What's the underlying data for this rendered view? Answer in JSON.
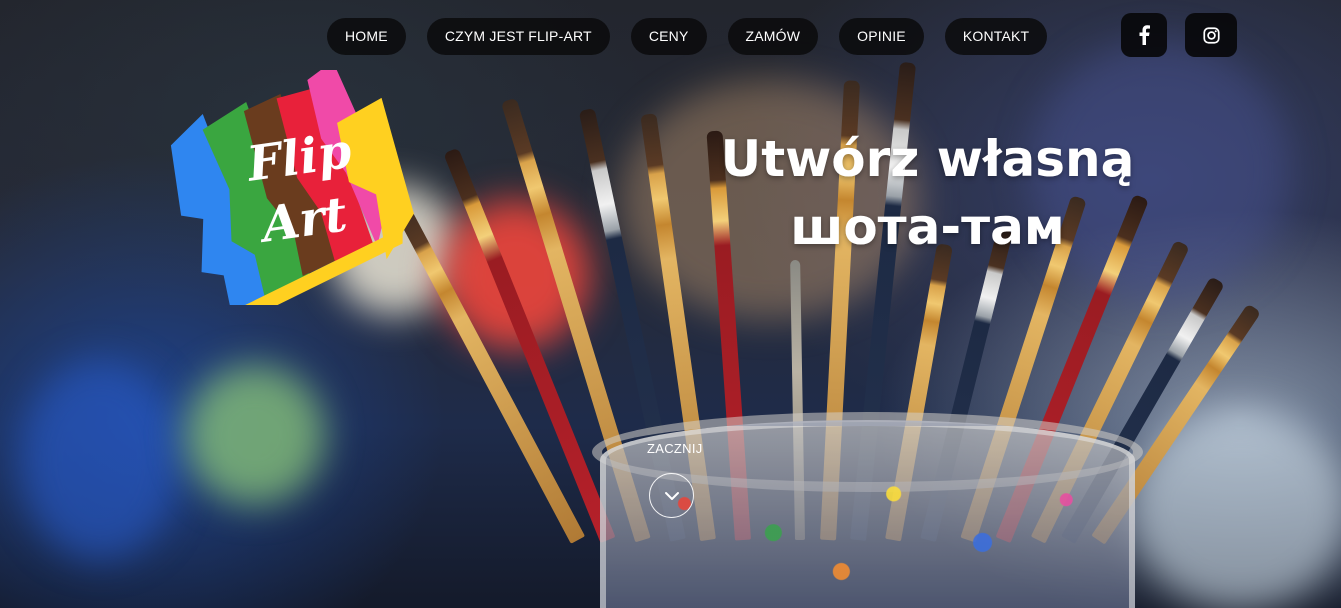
{
  "nav": {
    "items": [
      {
        "label": "HOME"
      },
      {
        "label": "CZYM JEST FLIP-ART"
      },
      {
        "label": "CENY"
      },
      {
        "label": "ZAMÓW"
      },
      {
        "label": "OPINIE"
      },
      {
        "label": "KONTAKT"
      }
    ]
  },
  "social": {
    "facebook_icon": "facebook-icon",
    "instagram_icon": "instagram-icon"
  },
  "logo": {
    "line1": "Flip",
    "line2": "Art",
    "colors": [
      "#2f86f0",
      "#3aa640",
      "#6a3c1e",
      "#e8213a",
      "#f04aa8",
      "#ffd020"
    ]
  },
  "hero": {
    "headline_line1": "Utwórz własną",
    "headline_line2": "шота-там"
  },
  "cta": {
    "label": "ZACZNIJ",
    "icon": "chevron-down-icon"
  }
}
